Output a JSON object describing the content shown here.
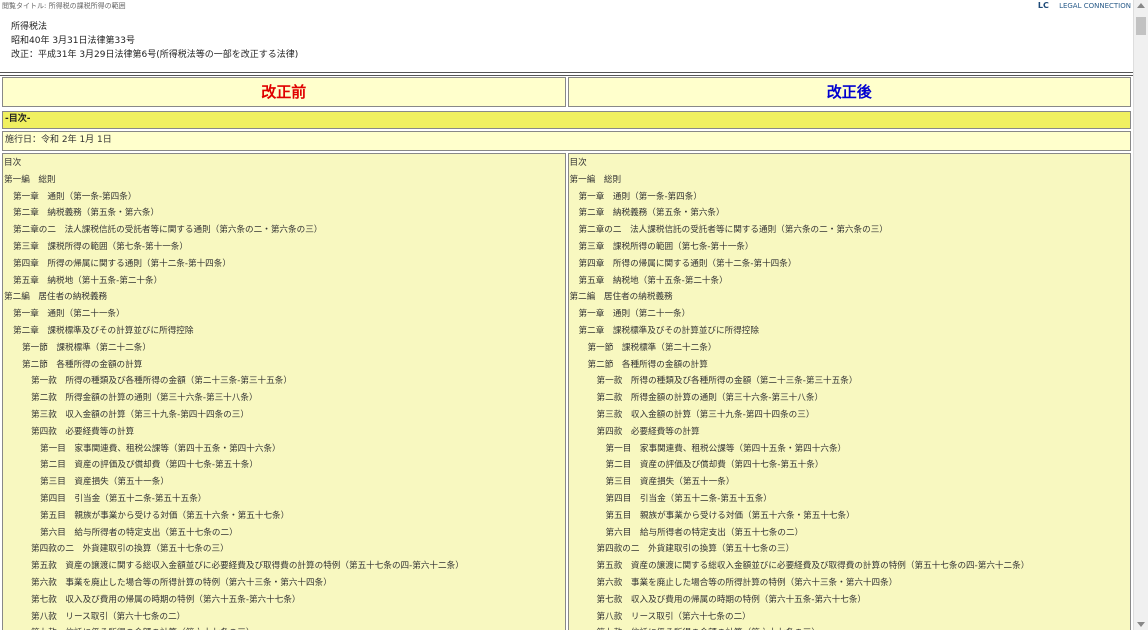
{
  "topbar": {
    "title": "閲覧タイトル: 所得税の課税所得の範囲",
    "brand_logo": "LC",
    "brand_name": "LEGAL CONNECTION"
  },
  "header": {
    "law_name": "所得税法",
    "promulgation": "昭和40年 3月31日法律第33号",
    "amendment": "改正：平成31年 3月29日法律第6号(所得税法等の一部を改正する法律)"
  },
  "comparison": {
    "before_label": "改正前",
    "after_label": "改正後",
    "section_label": "-目次-",
    "effective_date": "施行日：令和 2年 1月 1日"
  },
  "toc": {
    "before": [
      {
        "text": "目次",
        "level": 1
      },
      {
        "text": "第一編　総則",
        "level": 1
      },
      {
        "text": "第一章　通則（第一条-第四条）",
        "level": 2
      },
      {
        "text": "第二章　納税義務（第五条・第六条）",
        "level": 2
      },
      {
        "text": "第二章の二　法人課税信託の受託者等に関する通則（第六条の二・第六条の三）",
        "level": 2
      },
      {
        "text": "第三章　課税所得の範囲（第七条-第十一条）",
        "level": 2
      },
      {
        "text": "第四章　所得の帰属に関する通則（第十二条-第十四条）",
        "level": 2
      },
      {
        "text": "第五章　納税地（第十五条-第二十条）",
        "level": 2
      },
      {
        "text": "第二編　居住者の納税義務",
        "level": 1
      },
      {
        "text": "第一章　通則（第二十一条）",
        "level": 2
      },
      {
        "text": "第二章　課税標準及びその計算並びに所得控除",
        "level": 2
      },
      {
        "text": "第一節　課税標準（第二十二条）",
        "level": 3
      },
      {
        "text": "第二節　各種所得の金額の計算",
        "level": 3
      },
      {
        "text": "第一款　所得の種類及び各種所得の金額（第二十三条-第三十五条）",
        "level": 4
      },
      {
        "text": "第二款　所得金額の計算の通則（第三十六条-第三十八条）",
        "level": 4
      },
      {
        "text": "第三款　収入金額の計算（第三十九条-第四十四条の三）",
        "level": 4
      },
      {
        "text": "第四款　必要経費等の計算",
        "level": 4
      },
      {
        "text": "第一目　家事関連費、租税公課等（第四十五条・第四十六条）",
        "level": 5
      },
      {
        "text": "第二目　資産の評価及び償却費（第四十七条-第五十条）",
        "level": 5
      },
      {
        "text": "第三目　資産損失（第五十一条）",
        "level": 5
      },
      {
        "text": "第四目　引当金（第五十二条-第五十五条）",
        "level": 5
      },
      {
        "text": "第五目　親族が事業から受ける対価（第五十六条・第五十七条）",
        "level": 5
      },
      {
        "text": "第六目　給与所得者の特定支出（第五十七条の二）",
        "level": 5
      },
      {
        "text": "第四款の二　外貨建取引の換算（第五十七条の三）",
        "level": 4
      },
      {
        "text": "第五款　資産の譲渡に関する総収入金額並びに必要経費及び取得費の計算の特例（第五十七条の四-第六十二条）",
        "level": 4
      },
      {
        "text": "第六款　事業を廃止した場合等の所得計算の特例（第六十三条・第六十四条）",
        "level": 4
      },
      {
        "text": "第七款　収入及び費用の帰属の時期の特例（第六十五条-第六十七条）",
        "level": 4
      },
      {
        "text": "第八款　リース取引（第六十七条の二）",
        "level": 4
      },
      {
        "text": "第九款　信託に係る所得の金額の計算（第六十七条の三）",
        "level": 4
      }
    ],
    "after": [
      {
        "text": "目次",
        "level": 1
      },
      {
        "text": "第一編　総則",
        "level": 1
      },
      {
        "text": "第一章　通則（第一条-第四条）",
        "level": 2
      },
      {
        "text": "第二章　納税義務（第五条・第六条）",
        "level": 2
      },
      {
        "text": "第二章の二　法人課税信託の受託者等に関する通則（第六条の二・第六条の三）",
        "level": 2
      },
      {
        "text": "第三章　課税所得の範囲（第七条-第十一条）",
        "level": 2
      },
      {
        "text": "第四章　所得の帰属に関する通則（第十二条-第十四条）",
        "level": 2
      },
      {
        "text": "第五章　納税地（第十五条-第二十条）",
        "level": 2
      },
      {
        "text": "第二編　居住者の納税義務",
        "level": 1
      },
      {
        "text": "第一章　通則（第二十一条）",
        "level": 2
      },
      {
        "text": "第二章　課税標準及びその計算並びに所得控除",
        "level": 2
      },
      {
        "text": "第一節　課税標準（第二十二条）",
        "level": 3
      },
      {
        "text": "第二節　各種所得の金額の計算",
        "level": 3
      },
      {
        "text": "第一款　所得の種類及び各種所得の金額（第二十三条-第三十五条）",
        "level": 4
      },
      {
        "text": "第二款　所得金額の計算の通則（第三十六条-第三十八条）",
        "level": 4
      },
      {
        "text": "第三款　収入金額の計算（第三十九条-第四十四条の三）",
        "level": 4
      },
      {
        "text": "第四款　必要経費等の計算",
        "level": 4
      },
      {
        "text": "第一目　家事関連費、租税公課等（第四十五条・第四十六条）",
        "level": 5
      },
      {
        "text": "第二目　資産の評価及び償却費（第四十七条-第五十条）",
        "level": 5
      },
      {
        "text": "第三目　資産損失（第五十一条）",
        "level": 5
      },
      {
        "text": "第四目　引当金（第五十二条-第五十五条）",
        "level": 5
      },
      {
        "text": "第五目　親族が事業から受ける対価（第五十六条・第五十七条）",
        "level": 5
      },
      {
        "text": "第六目　給与所得者の特定支出（第五十七条の二）",
        "level": 5
      },
      {
        "text": "第四款の二　外貨建取引の換算（第五十七条の三）",
        "level": 4
      },
      {
        "text": "第五款　資産の譲渡に関する総収入金額並びに必要経費及び取得費の計算の特例（第五十七条の四-第六十二条）",
        "level": 4
      },
      {
        "text": "第六款　事業を廃止した場合等の所得計算の特例（第六十三条・第六十四条）",
        "level": 4
      },
      {
        "text": "第七款　収入及び費用の帰属の時期の特例（第六十五条-第六十七条）",
        "level": 4
      },
      {
        "text": "第八款　リース取引（第六十七条の二）",
        "level": 4
      },
      {
        "text": "第九款　信託に係る所得の金額の計算（第六十七条の三）",
        "level": 4
      }
    ]
  }
}
